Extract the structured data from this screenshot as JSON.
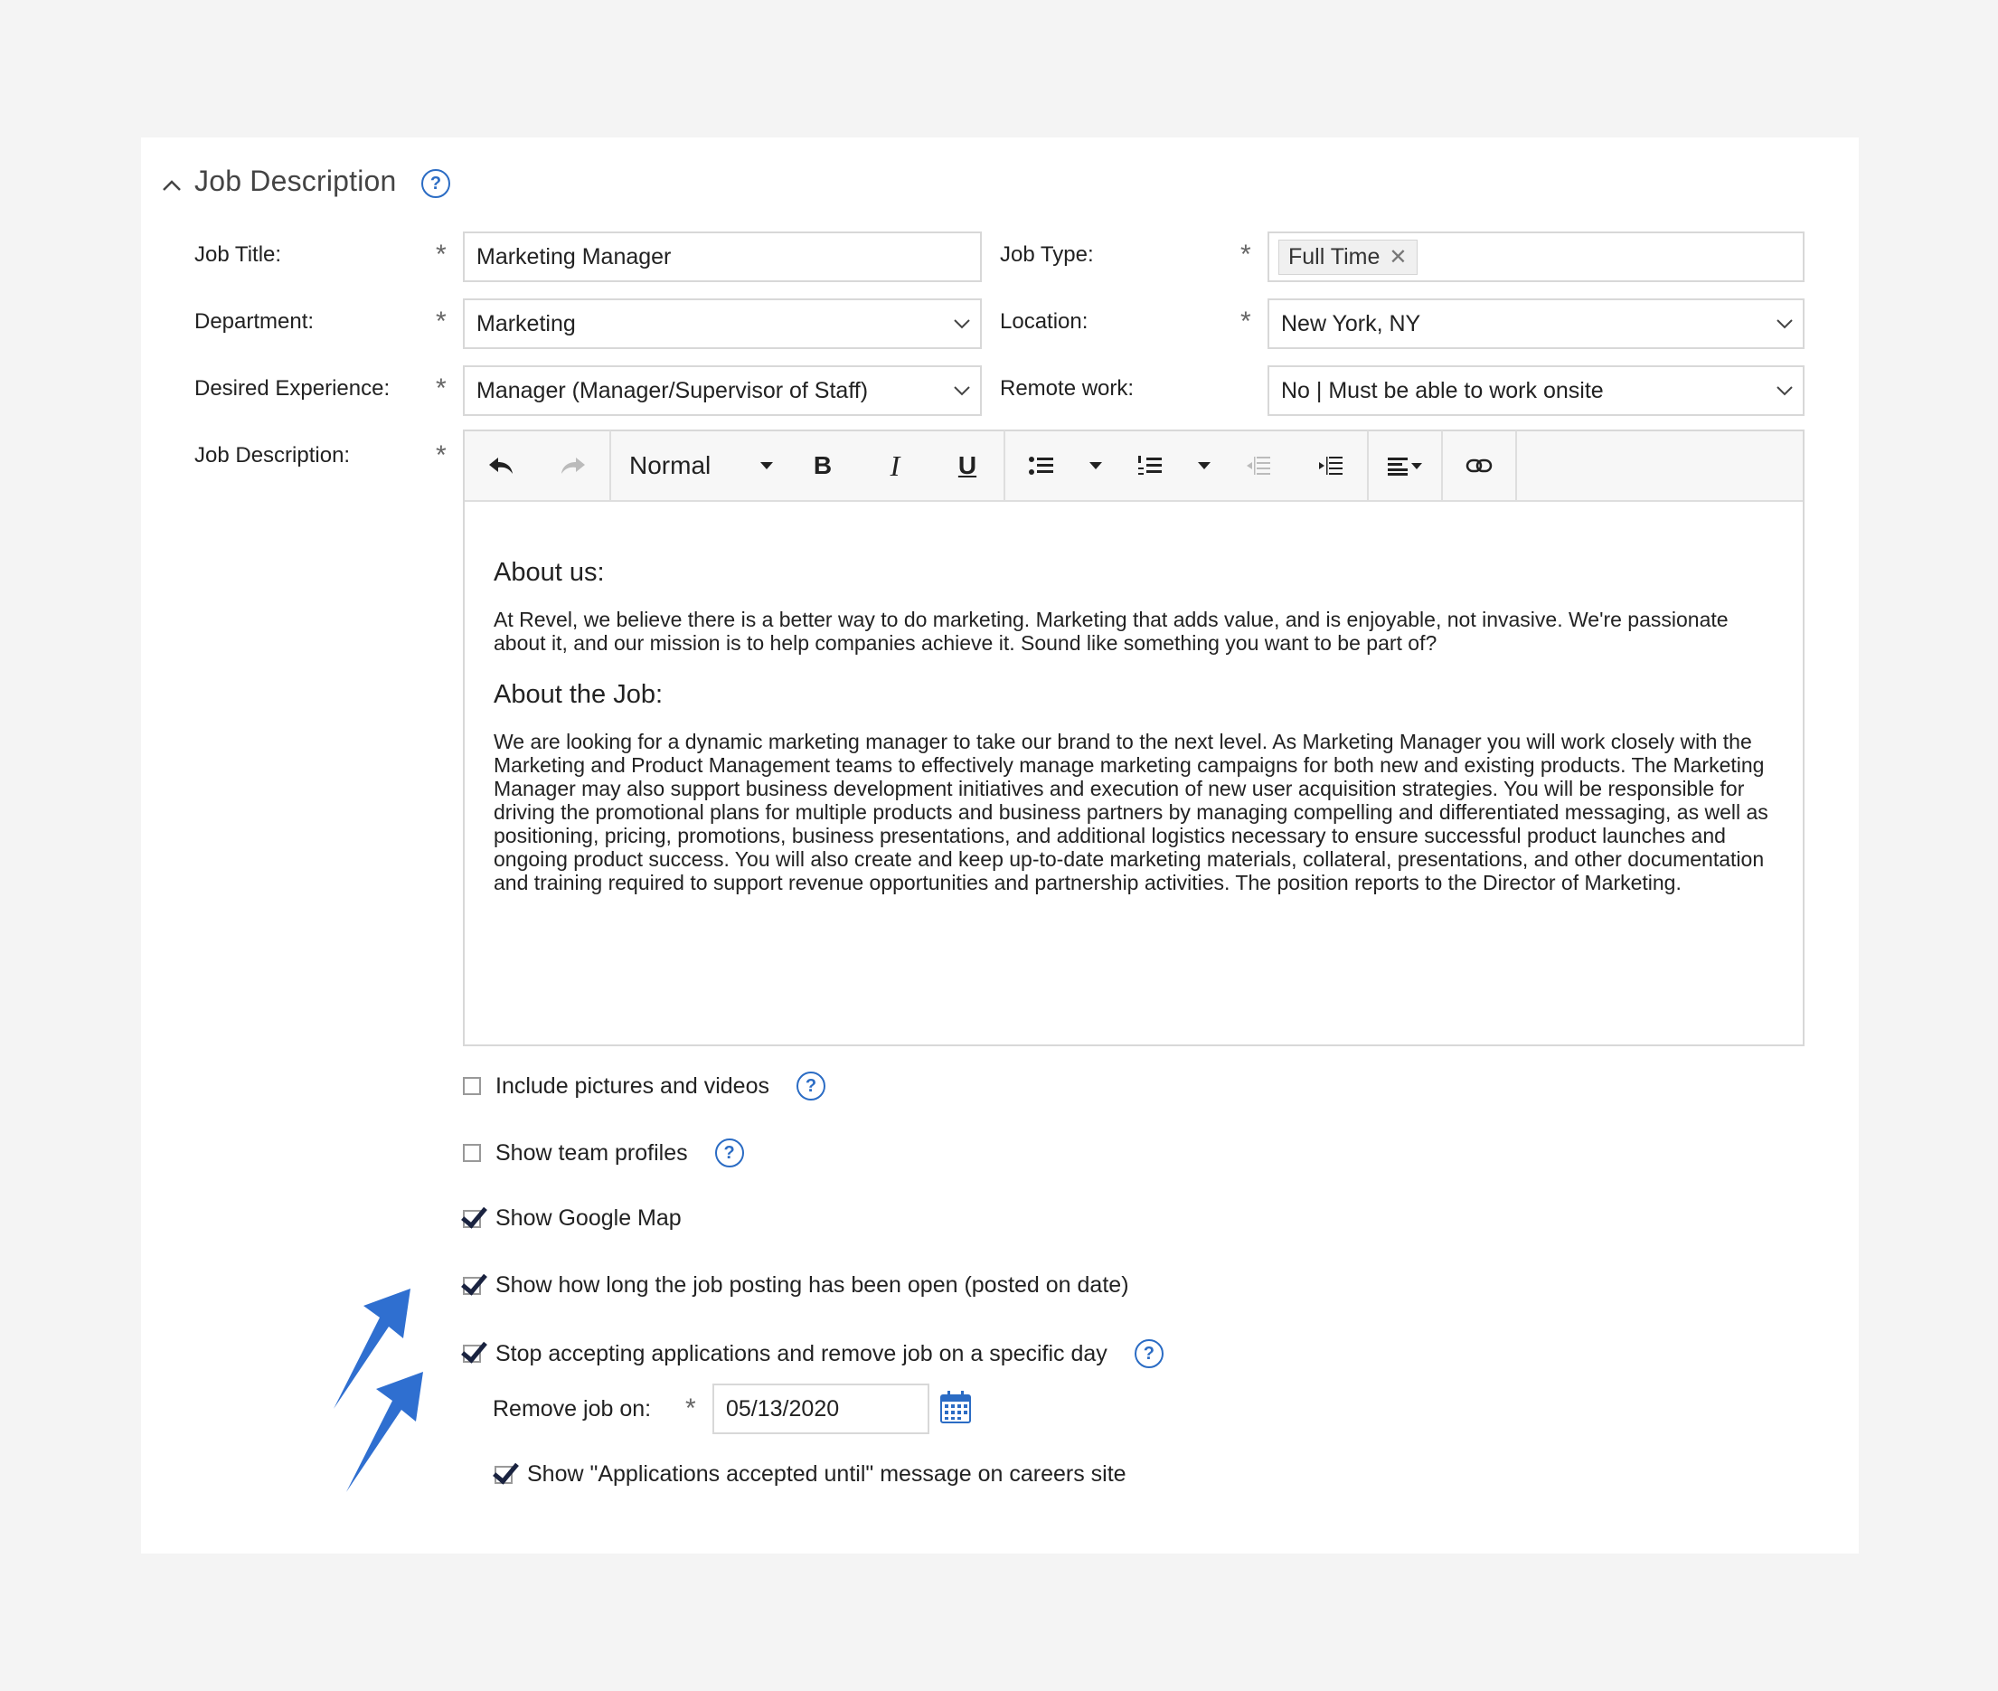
{
  "section": {
    "title": "Job Description"
  },
  "fields": {
    "job_title": {
      "label": "Job Title:",
      "value": "Marketing Manager"
    },
    "job_type": {
      "label": "Job Type:",
      "chip": "Full Time"
    },
    "department": {
      "label": "Department:",
      "value": "Marketing"
    },
    "location": {
      "label": "Location:",
      "value": "New York, NY"
    },
    "experience": {
      "label": "Desired Experience:",
      "value": "Manager (Manager/Supervisor of Staff)"
    },
    "remote": {
      "label": "Remote work:",
      "value": "No | Must be able to work onsite"
    },
    "description": {
      "label": "Job Description:"
    }
  },
  "required_mark": "*",
  "editor": {
    "format_select": "Normal",
    "bold": "B",
    "italic": "I",
    "underline": "U",
    "heading1": "About us:",
    "para1": "At Revel, we believe there is a better way to do marketing. Marketing that adds value, and is enjoyable, not invasive. We're passionate about it, and our mission is to help companies achieve it. Sound like something you want to be part of?",
    "heading2": "About the Job:",
    "para2": "We are looking for a dynamic marketing manager to take our brand to the next level. As Marketing Manager you will work closely with the Marketing and Product Management teams to effectively manage marketing campaigns for both new and existing products. The Marketing Manager may also support business development initiatives and execution of new user acquisition strategies. You will be responsible for driving the promotional plans for multiple products and business partners by managing compelling and differentiated messaging, as well as positioning, pricing, promotions, business presentations, and additional logistics necessary to ensure successful product launches and ongoing product success. You will also create and keep up-to-date marketing materials, collateral, presentations, and other documentation and training required to support revenue opportunities and partnership activities. The position reports to the Director of Marketing."
  },
  "options": {
    "pictures": {
      "label": "Include pictures and videos",
      "checked": false
    },
    "team": {
      "label": "Show team profiles",
      "checked": false
    },
    "map": {
      "label": "Show Google Map",
      "checked": true
    },
    "posted": {
      "label": "Show how long the job posting has been open (posted on date)",
      "checked": true
    },
    "stop": {
      "label": "Stop accepting applications and remove job on a specific day",
      "checked": true
    },
    "remove_label": "Remove job on:",
    "remove_date": "05/13/2020",
    "accepted": {
      "label": "Show \"Applications accepted until\" message on careers site",
      "checked": true
    }
  },
  "help_glyph": "?",
  "colors": {
    "accent": "#2b6cc4",
    "arrow": "#2f6fd0",
    "check": "#1a2340"
  },
  "icons": [
    "chevron-up-icon",
    "help-icon",
    "chevron-down-icon",
    "undo-icon",
    "redo-icon",
    "bullet-list-icon",
    "numbered-list-icon",
    "outdent-icon",
    "indent-icon",
    "align-icon",
    "link-icon",
    "calendar-icon",
    "arrow-icon"
  ]
}
